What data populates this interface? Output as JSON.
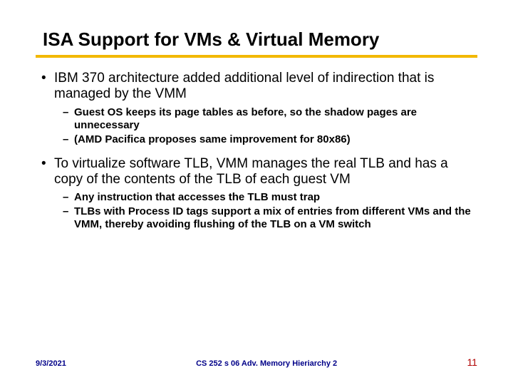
{
  "title": "ISA Support for VMs & Virtual Memory",
  "bullets": [
    {
      "text": "IBM 370 architecture added additional level of indirection that is managed by the VMM",
      "subs": [
        "Guest OS keeps its page tables as before, so the shadow pages are unnecessary",
        "(AMD Pacifica proposes same improvement for 80x86)"
      ]
    },
    {
      "text": "To virtualize software TLB, VMM manages the real TLB and has a copy of the contents of the TLB of each guest VM",
      "subs": [
        "Any instruction that accesses the TLB must trap",
        "TLBs with Process ID tags support a mix of entries from different VMs and the VMM, thereby avoiding flushing of the TLB on a VM switch"
      ]
    }
  ],
  "footer": {
    "date": "9/3/2021",
    "course": "CS 252 s 06 Adv. Memory Hieriarchy 2",
    "page": "11"
  }
}
